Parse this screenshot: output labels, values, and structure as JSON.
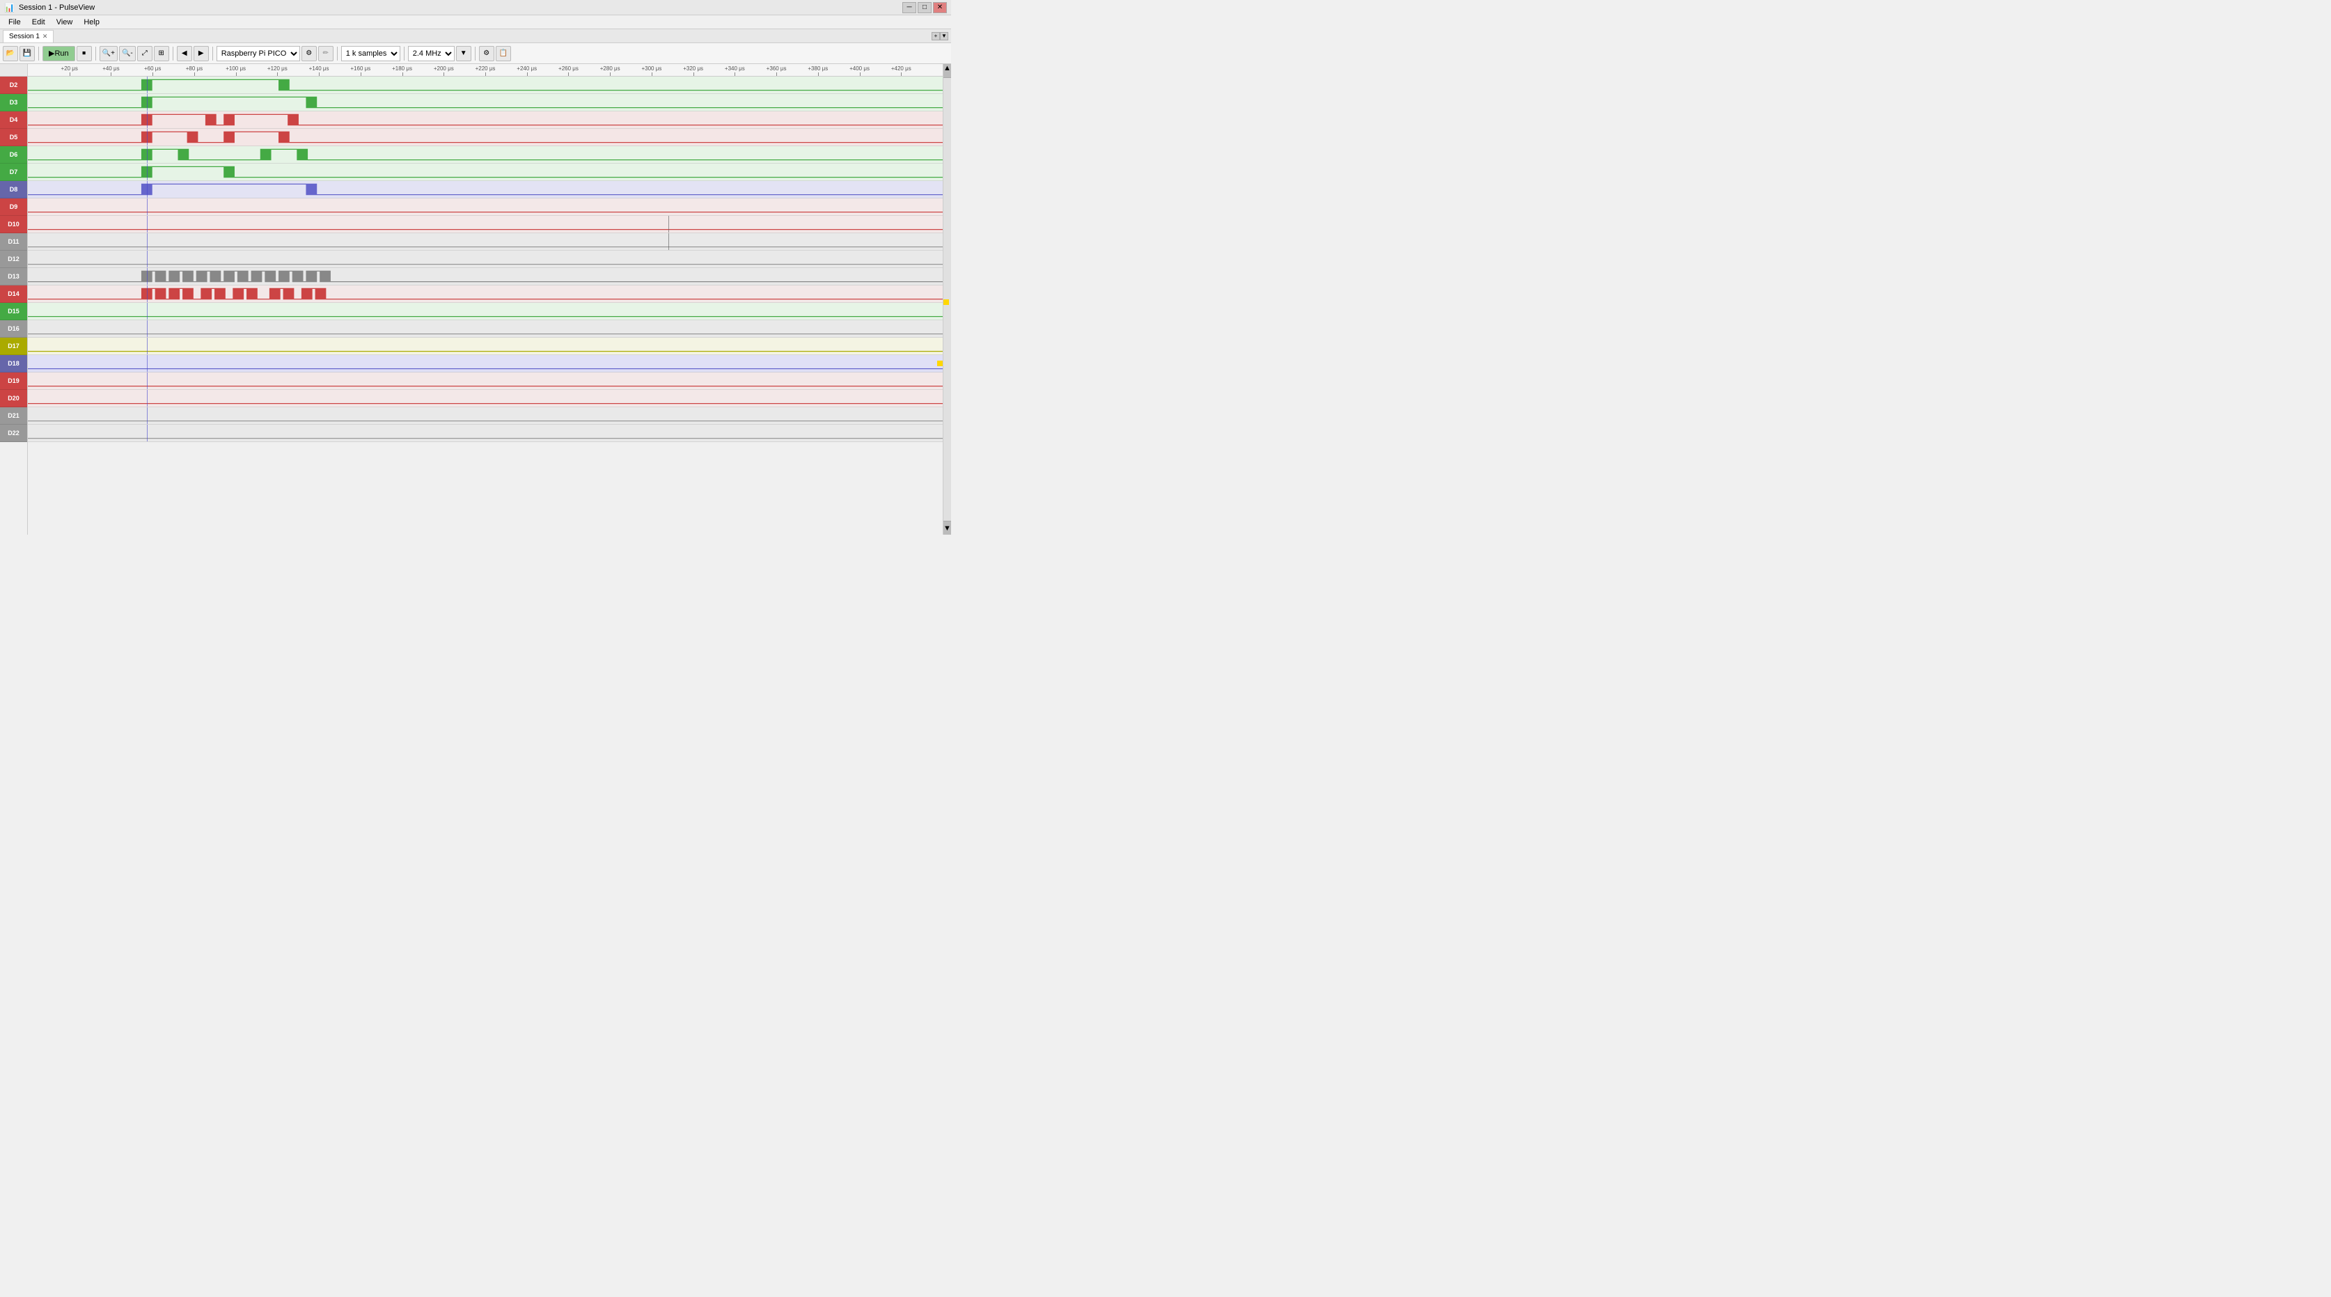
{
  "titlebar": {
    "title": "Session 1 - PulseView",
    "minimize": "─",
    "maximize": "□",
    "close": "✕"
  },
  "menubar": {
    "items": [
      "File",
      "Edit",
      "View",
      "Help"
    ]
  },
  "sessionbar": {
    "label": "Session 1"
  },
  "toolbar": {
    "run_label": "Run",
    "device": "Raspberry Pi PICO",
    "samples": "1 k samples",
    "rate": "2.4 MHz",
    "buttons": {
      "open": "📂",
      "save": "💾",
      "run": "▶",
      "stop": "⏹",
      "zoom_in": "+",
      "zoom_out": "−",
      "zoom_fit": "⤢",
      "zoom_sel": "⊞",
      "markers": "⚑",
      "configure": "⚙",
      "probe": "✏",
      "decoder": "⊕"
    }
  },
  "time_ruler": {
    "ticks": [
      "+20 μs",
      "+40 μs",
      "+60 μs",
      "+80 μs",
      "+100 μs",
      "+120 μs",
      "+140 μs",
      "+160 μs",
      "+180 μs",
      "+200 μs",
      "+220 μs",
      "+240 μs",
      "+260 μs",
      "+280 μs",
      "+300 μs",
      "+320 μs",
      "+340 μs",
      "+360 μs",
      "+380 μs",
      "+400 μs",
      "+420 μs"
    ]
  },
  "channels": [
    {
      "id": "D2",
      "color": "#e06060",
      "label_bg": "#e06060",
      "signal": "high_pulse_mid",
      "bg": "red"
    },
    {
      "id": "D3",
      "color": "#60c060",
      "label_bg": "#60c060",
      "signal": "high_pulse_long",
      "bg": "green"
    },
    {
      "id": "D4",
      "color": "#e06060",
      "label_bg": "#e06060",
      "signal": "double_pulse",
      "bg": "red"
    },
    {
      "id": "D5",
      "color": "#e06060",
      "label_bg": "#e06060",
      "signal": "double_pulse_2",
      "bg": "red"
    },
    {
      "id": "D6",
      "color": "#60c060",
      "label_bg": "#60c060",
      "signal": "short_pulse_pair",
      "bg": "green"
    },
    {
      "id": "D7",
      "color": "#60c060",
      "label_bg": "#60c060",
      "signal": "medium_pulse",
      "bg": "green"
    },
    {
      "id": "D8",
      "color": "#8080c0",
      "label_bg": "#8080c0",
      "signal": "wide_pulse_blue",
      "bg": "blue"
    },
    {
      "id": "D9",
      "color": "#c06060",
      "label_bg": "#c06060",
      "signal": "flat_red",
      "bg": "red"
    },
    {
      "id": "D10",
      "color": "#e06060",
      "label_bg": "#e06060",
      "signal": "flat_red_cursor",
      "bg": "red"
    },
    {
      "id": "D11",
      "color": "#c0c0c0",
      "label_bg": "#c0c0c0",
      "signal": "flat_gray_cursor",
      "bg": "gray"
    },
    {
      "id": "D12",
      "color": "#c0c0c0",
      "label_bg": "#c0c0c0",
      "signal": "flat_gray",
      "bg": "gray"
    },
    {
      "id": "D13",
      "color": "#c0c0c0",
      "label_bg": "#c0c0c0",
      "signal": "multi_pulse_gray",
      "bg": "gray"
    },
    {
      "id": "D14",
      "color": "#e06060",
      "label_bg": "#e06060",
      "signal": "multi_pulse_red",
      "bg": "red"
    },
    {
      "id": "D15",
      "color": "#60c060",
      "label_bg": "#60c060",
      "signal": "flat_green",
      "bg": "green"
    },
    {
      "id": "D16",
      "color": "#c0c0c0",
      "label_bg": "#c0c0c0",
      "signal": "flat_gray2",
      "bg": "gray"
    },
    {
      "id": "D17",
      "color": "#d0d000",
      "label_bg": "#d0d000",
      "signal": "flat_yellow",
      "bg": "yellow"
    },
    {
      "id": "D18",
      "color": "#8080c0",
      "label_bg": "#8080c0",
      "signal": "flat_blue",
      "bg": "blue"
    },
    {
      "id": "D19",
      "color": "#e06060",
      "label_bg": "#e06060",
      "signal": "flat_red2",
      "bg": "red"
    },
    {
      "id": "D20",
      "color": "#e06060",
      "label_bg": "#e06060",
      "signal": "flat_red3",
      "bg": "red"
    },
    {
      "id": "D21",
      "color": "#c0c0c0",
      "label_bg": "#c0c0c0",
      "signal": "flat_gray3",
      "bg": "gray"
    },
    {
      "id": "D22",
      "color": "#c0c0c0",
      "label_bg": "#c0c0c0",
      "signal": "flat_gray4",
      "bg": "gray"
    }
  ],
  "label_colors": {
    "D2": "#cc4444",
    "D3": "#44aa44",
    "D4": "#cc4444",
    "D5": "#cc4444",
    "D6": "#44aa44",
    "D7": "#44aa44",
    "D8": "#6666aa",
    "D9": "#cc4444",
    "D10": "#cc4444",
    "D11": "#999999",
    "D12": "#999999",
    "D13": "#999999",
    "D14": "#cc4444",
    "D15": "#44aa44",
    "D16": "#999999",
    "D17": "#aaaa00",
    "D18": "#6666aa",
    "D19": "#cc4444",
    "D20": "#cc4444",
    "D21": "#999999",
    "D22": "#999999"
  },
  "trigger_x_percent": 13,
  "cursor_x_percent": 70,
  "session_tab": "Session 1"
}
